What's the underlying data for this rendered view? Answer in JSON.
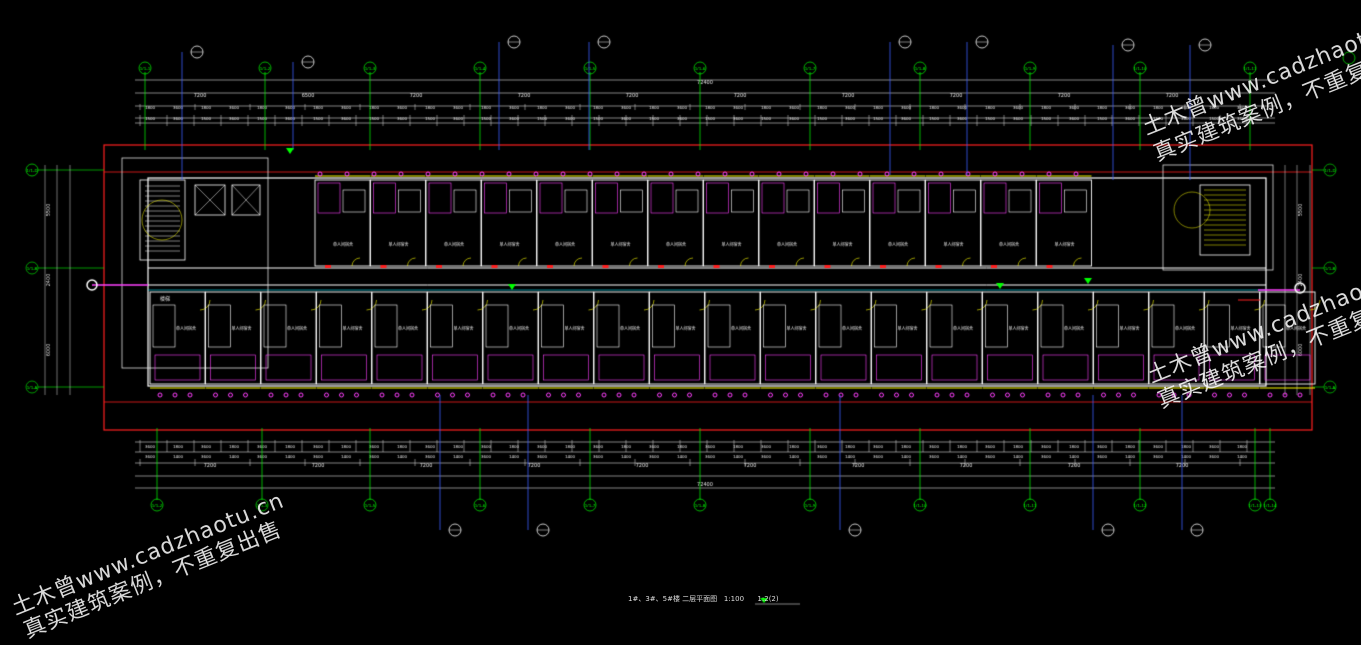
{
  "drawing": {
    "title": "1#、3#、5#楼 二层平面图",
    "scale": "1:100",
    "bottom_tag": "1:2(2)",
    "top_total_dim": "72400",
    "bottom_total_dim": "72400",
    "top_bay_dims": [
      "7200",
      "6500",
      "7200",
      "7200",
      "7200",
      "7200",
      "7200",
      "7200",
      "7200",
      "7200"
    ],
    "bottom_bay_dims": [
      "7200",
      "7200",
      "7200",
      "7200",
      "7200",
      "7200",
      "7200",
      "7200",
      "7200",
      "7200"
    ],
    "depth_dims": [
      "5500",
      "2400",
      "6000"
    ],
    "room_label": "单人间宿舍",
    "stair_label": "楼梯",
    "top_axes": [
      "1/1-1",
      "1/1-2",
      "1/1-3",
      "1/1-4",
      "1/1-5",
      "1/1-6",
      "1/1-7",
      "1/1-8",
      "1/1-9",
      "1/1-10",
      "1/1-11",
      "1/1-12",
      "1/1-13"
    ],
    "bottom_axes": [
      "1/1-2",
      "1/1-3",
      "1/1-5",
      "1/1-6",
      "1/1-7",
      "1/1-8",
      "1/1-9",
      "1/1-10",
      "1/1-11",
      "1/1-12",
      "1/1-13",
      "1/1-14"
    ],
    "left_axes": [
      "1/1-D",
      "1/1-C",
      "1/1-B",
      "1/1-A"
    ],
    "right_axes": [
      "1/1-D",
      "1/1-C",
      "1/1-B",
      "1/1-A"
    ]
  },
  "watermarks": {
    "line1": "土木曾www.cadzhaotu.cn",
    "line2": "真实建筑案例，不重复出售"
  },
  "colors": {
    "background": "#000000",
    "axis": "#00ff00",
    "wall": "#ffffff",
    "frame": "#ff2020",
    "leader": "#3a5bff",
    "fixtures": "#ff40ff",
    "doors": "#ffff00",
    "dims": "#e0e0e0",
    "cyan": "#00e5ff"
  }
}
